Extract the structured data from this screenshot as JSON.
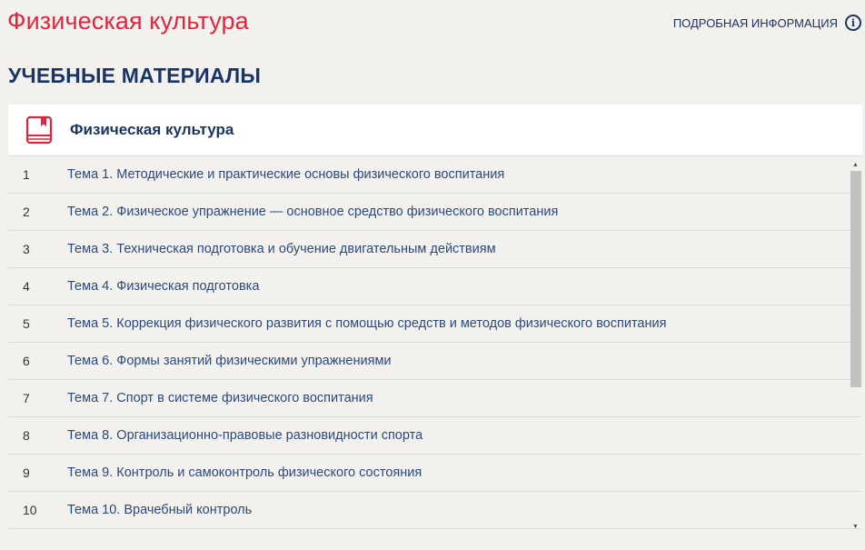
{
  "header": {
    "title": "Физическая культура",
    "info_label": "ПОДРОБНАЯ ИНФОРМАЦИЯ",
    "info_icon": "info-circle-icon",
    "title_color": "#e0263e"
  },
  "section": {
    "title": "УЧЕБНЫЕ МАТЕРИАЛЫ"
  },
  "course": {
    "title": "Физическая культура",
    "icon": "book-icon",
    "icon_color": "#e0263e"
  },
  "topics": [
    {
      "num": "1",
      "title": "Тема 1. Методические и практические основы физического воспитания"
    },
    {
      "num": "2",
      "title": "Тема 2. Физическое упражнение — основное средство физического воспитания"
    },
    {
      "num": "3",
      "title": "Тема 3. Техническая подготовка и обучение двигательным действиям"
    },
    {
      "num": "4",
      "title": "Тема 4. Физическая подготовка"
    },
    {
      "num": "5",
      "title": "Тема 5. Коррекция физического развития с помощью средств и методов физического воспитания"
    },
    {
      "num": "6",
      "title": "Тема 6. Формы занятий физическими упражнениями"
    },
    {
      "num": "7",
      "title": "Тема 7. Спорт в системе физического воспитания"
    },
    {
      "num": "8",
      "title": "Тема 8. Организационно-правовые разновидности спорта"
    },
    {
      "num": "9",
      "title": "Тема 9. Контроль и самоконтроль физического состояния"
    },
    {
      "num": "10",
      "title": "Тема 10. Врачебный контроль"
    }
  ]
}
